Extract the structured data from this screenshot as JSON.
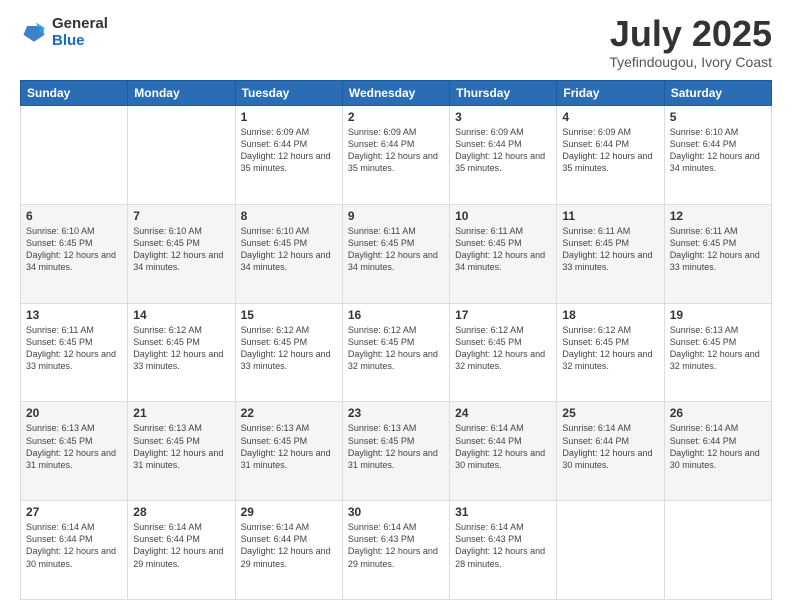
{
  "header": {
    "logo_general": "General",
    "logo_blue": "Blue",
    "month_title": "July 2025",
    "subtitle": "Tyefindougou, Ivory Coast"
  },
  "calendar": {
    "days_of_week": [
      "Sunday",
      "Monday",
      "Tuesday",
      "Wednesday",
      "Thursday",
      "Friday",
      "Saturday"
    ],
    "weeks": [
      [
        {
          "day": "",
          "sunrise": "",
          "sunset": "",
          "daylight": ""
        },
        {
          "day": "",
          "sunrise": "",
          "sunset": "",
          "daylight": ""
        },
        {
          "day": "1",
          "sunrise": "Sunrise: 6:09 AM",
          "sunset": "Sunset: 6:44 PM",
          "daylight": "Daylight: 12 hours and 35 minutes."
        },
        {
          "day": "2",
          "sunrise": "Sunrise: 6:09 AM",
          "sunset": "Sunset: 6:44 PM",
          "daylight": "Daylight: 12 hours and 35 minutes."
        },
        {
          "day": "3",
          "sunrise": "Sunrise: 6:09 AM",
          "sunset": "Sunset: 6:44 PM",
          "daylight": "Daylight: 12 hours and 35 minutes."
        },
        {
          "day": "4",
          "sunrise": "Sunrise: 6:09 AM",
          "sunset": "Sunset: 6:44 PM",
          "daylight": "Daylight: 12 hours and 35 minutes."
        },
        {
          "day": "5",
          "sunrise": "Sunrise: 6:10 AM",
          "sunset": "Sunset: 6:44 PM",
          "daylight": "Daylight: 12 hours and 34 minutes."
        }
      ],
      [
        {
          "day": "6",
          "sunrise": "Sunrise: 6:10 AM",
          "sunset": "Sunset: 6:45 PM",
          "daylight": "Daylight: 12 hours and 34 minutes."
        },
        {
          "day": "7",
          "sunrise": "Sunrise: 6:10 AM",
          "sunset": "Sunset: 6:45 PM",
          "daylight": "Daylight: 12 hours and 34 minutes."
        },
        {
          "day": "8",
          "sunrise": "Sunrise: 6:10 AM",
          "sunset": "Sunset: 6:45 PM",
          "daylight": "Daylight: 12 hours and 34 minutes."
        },
        {
          "day": "9",
          "sunrise": "Sunrise: 6:11 AM",
          "sunset": "Sunset: 6:45 PM",
          "daylight": "Daylight: 12 hours and 34 minutes."
        },
        {
          "day": "10",
          "sunrise": "Sunrise: 6:11 AM",
          "sunset": "Sunset: 6:45 PM",
          "daylight": "Daylight: 12 hours and 34 minutes."
        },
        {
          "day": "11",
          "sunrise": "Sunrise: 6:11 AM",
          "sunset": "Sunset: 6:45 PM",
          "daylight": "Daylight: 12 hours and 33 minutes."
        },
        {
          "day": "12",
          "sunrise": "Sunrise: 6:11 AM",
          "sunset": "Sunset: 6:45 PM",
          "daylight": "Daylight: 12 hours and 33 minutes."
        }
      ],
      [
        {
          "day": "13",
          "sunrise": "Sunrise: 6:11 AM",
          "sunset": "Sunset: 6:45 PM",
          "daylight": "Daylight: 12 hours and 33 minutes."
        },
        {
          "day": "14",
          "sunrise": "Sunrise: 6:12 AM",
          "sunset": "Sunset: 6:45 PM",
          "daylight": "Daylight: 12 hours and 33 minutes."
        },
        {
          "day": "15",
          "sunrise": "Sunrise: 6:12 AM",
          "sunset": "Sunset: 6:45 PM",
          "daylight": "Daylight: 12 hours and 33 minutes."
        },
        {
          "day": "16",
          "sunrise": "Sunrise: 6:12 AM",
          "sunset": "Sunset: 6:45 PM",
          "daylight": "Daylight: 12 hours and 32 minutes."
        },
        {
          "day": "17",
          "sunrise": "Sunrise: 6:12 AM",
          "sunset": "Sunset: 6:45 PM",
          "daylight": "Daylight: 12 hours and 32 minutes."
        },
        {
          "day": "18",
          "sunrise": "Sunrise: 6:12 AM",
          "sunset": "Sunset: 6:45 PM",
          "daylight": "Daylight: 12 hours and 32 minutes."
        },
        {
          "day": "19",
          "sunrise": "Sunrise: 6:13 AM",
          "sunset": "Sunset: 6:45 PM",
          "daylight": "Daylight: 12 hours and 32 minutes."
        }
      ],
      [
        {
          "day": "20",
          "sunrise": "Sunrise: 6:13 AM",
          "sunset": "Sunset: 6:45 PM",
          "daylight": "Daylight: 12 hours and 31 minutes."
        },
        {
          "day": "21",
          "sunrise": "Sunrise: 6:13 AM",
          "sunset": "Sunset: 6:45 PM",
          "daylight": "Daylight: 12 hours and 31 minutes."
        },
        {
          "day": "22",
          "sunrise": "Sunrise: 6:13 AM",
          "sunset": "Sunset: 6:45 PM",
          "daylight": "Daylight: 12 hours and 31 minutes."
        },
        {
          "day": "23",
          "sunrise": "Sunrise: 6:13 AM",
          "sunset": "Sunset: 6:45 PM",
          "daylight": "Daylight: 12 hours and 31 minutes."
        },
        {
          "day": "24",
          "sunrise": "Sunrise: 6:14 AM",
          "sunset": "Sunset: 6:44 PM",
          "daylight": "Daylight: 12 hours and 30 minutes."
        },
        {
          "day": "25",
          "sunrise": "Sunrise: 6:14 AM",
          "sunset": "Sunset: 6:44 PM",
          "daylight": "Daylight: 12 hours and 30 minutes."
        },
        {
          "day": "26",
          "sunrise": "Sunrise: 6:14 AM",
          "sunset": "Sunset: 6:44 PM",
          "daylight": "Daylight: 12 hours and 30 minutes."
        }
      ],
      [
        {
          "day": "27",
          "sunrise": "Sunrise: 6:14 AM",
          "sunset": "Sunset: 6:44 PM",
          "daylight": "Daylight: 12 hours and 30 minutes."
        },
        {
          "day": "28",
          "sunrise": "Sunrise: 6:14 AM",
          "sunset": "Sunset: 6:44 PM",
          "daylight": "Daylight: 12 hours and 29 minutes."
        },
        {
          "day": "29",
          "sunrise": "Sunrise: 6:14 AM",
          "sunset": "Sunset: 6:44 PM",
          "daylight": "Daylight: 12 hours and 29 minutes."
        },
        {
          "day": "30",
          "sunrise": "Sunrise: 6:14 AM",
          "sunset": "Sunset: 6:43 PM",
          "daylight": "Daylight: 12 hours and 29 minutes."
        },
        {
          "day": "31",
          "sunrise": "Sunrise: 6:14 AM",
          "sunset": "Sunset: 6:43 PM",
          "daylight": "Daylight: 12 hours and 28 minutes."
        },
        {
          "day": "",
          "sunrise": "",
          "sunset": "",
          "daylight": ""
        },
        {
          "day": "",
          "sunrise": "",
          "sunset": "",
          "daylight": ""
        }
      ]
    ]
  }
}
